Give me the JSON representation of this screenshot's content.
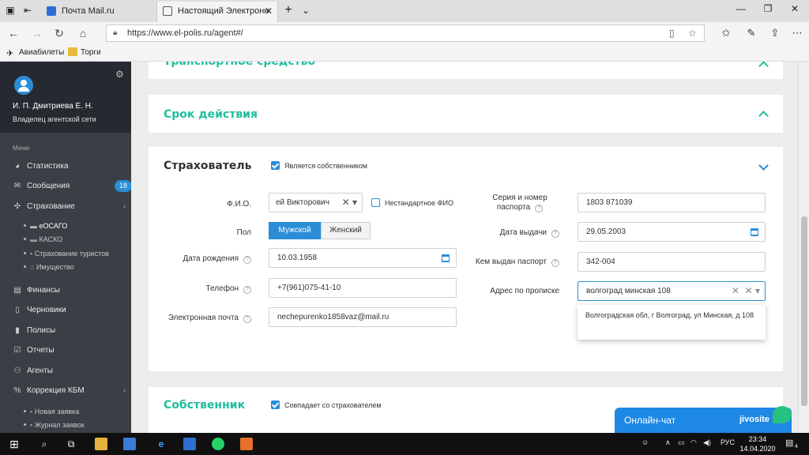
{
  "browser": {
    "tab_inactive": "Почта Mail.ru",
    "tab_active": "Настоящий Электронн",
    "url": "https://www.el-polis.ru/agent#/",
    "favorites": [
      "Авиабилеты",
      "Торги"
    ]
  },
  "sidebar": {
    "user_name": "И. П. Дмитриева Е. Н.",
    "user_role": "Владелец агентской сети",
    "menu_title": "Меню",
    "items": {
      "stats": "Статистика",
      "messages": "Сообщения",
      "messages_badge": "18",
      "insurance": "Страхование",
      "finance": "Финансы",
      "drafts": "Черновики",
      "policies": "Полисы",
      "reports": "Отчеты",
      "agents": "Агенты",
      "kbm": "Коррекция КБМ"
    },
    "insurance_sub": [
      "еОСАГО",
      "КАСКО",
      "Страхование туристов",
      "Имущество"
    ],
    "kbm_sub": [
      "Новая заявка",
      "Журнал заявок"
    ]
  },
  "sections": {
    "vehicle_title": "Транспортное средство",
    "term_title": "Срок действия",
    "insurer_title": "Страхователь",
    "owner_title": "Собственник"
  },
  "insurer": {
    "is_owner_label": "Является собственником",
    "fio_label": "Ф.И.О.",
    "fio_value": "ей Викторович",
    "nonstandard_fio_label": "Нестандартное ФИО",
    "gender_label": "Пол",
    "gender_male": "Мужской",
    "gender_female": "Женский",
    "birth_label": "Дата рождения",
    "birth_value": "10.03.1958",
    "phone_label": "Телефон",
    "phone_value": "+7(961)075-41-10",
    "email_label": "Электронная почта",
    "email_value": "nechepurenko1858vaz@mail.ru",
    "passport_series_label_1": "Серия и номер",
    "passport_series_label_2": "паспорта",
    "passport_series_value": "1803 871039",
    "issue_date_label": "Дата выдачи",
    "issue_date_value": "29.05.2003",
    "issued_by_label": "Кем выдан паспорт",
    "issued_by_value": "342-004",
    "address_label": "Адрес по прописке",
    "address_value": "волгоград минская 108",
    "address_suggestion": "Волгоградская обл, г Волгоград, ул Минская, д 108"
  },
  "owner": {
    "same_as_insurer_label": "Совпадает со страхователем"
  },
  "chat": {
    "label": "Онлайн-чат",
    "brand": "jivosite"
  },
  "taskbar": {
    "lang": "РУС",
    "time": "23:34",
    "date": "14.04.2020",
    "notif_count": "4"
  },
  "colors": {
    "accent_green": "#1fbf9e",
    "accent_blue": "#2b8dd6",
    "sidebar_bg": "#3a3f46"
  }
}
